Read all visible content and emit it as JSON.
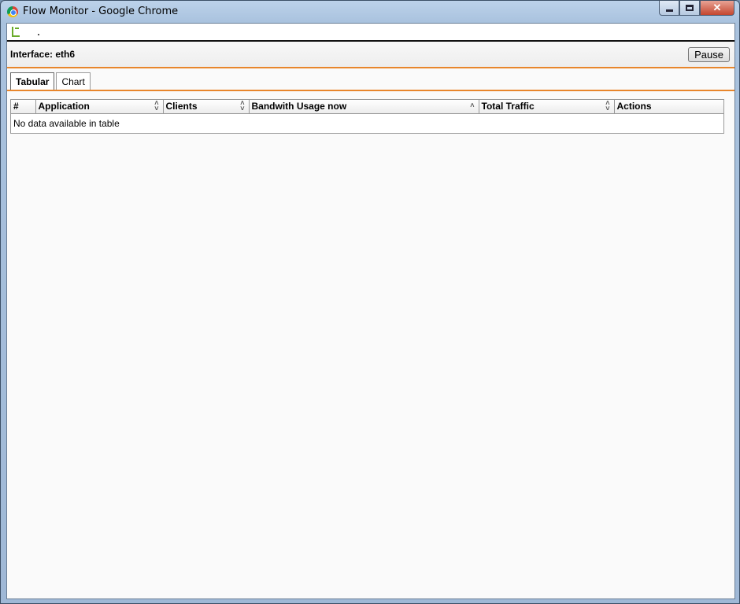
{
  "window": {
    "title": "Flow Monitor - Google Chrome",
    "close_label": "✕"
  },
  "address_bar": {
    "text": "."
  },
  "panel": {
    "interface_title": "Interface: eth6",
    "pause_label": "Pause"
  },
  "tabs": [
    {
      "label": "Tabular",
      "active": true
    },
    {
      "label": "Chart",
      "active": false
    }
  ],
  "table": {
    "columns": [
      {
        "label": "#",
        "sort": ""
      },
      {
        "label": "Application",
        "sort": "both"
      },
      {
        "label": "Clients",
        "sort": "both"
      },
      {
        "label": "Bandwith Usage now",
        "sort": "asc"
      },
      {
        "label": "Total Traffic",
        "sort": "both"
      },
      {
        "label": "Actions",
        "sort": ""
      }
    ],
    "empty_message": "No data available in table"
  },
  "colors": {
    "accent": "#e8862c"
  },
  "icons": {
    "browser": "chrome-icon",
    "page": "page-icon",
    "sort_both": "⇕",
    "sort_asc": "^"
  }
}
